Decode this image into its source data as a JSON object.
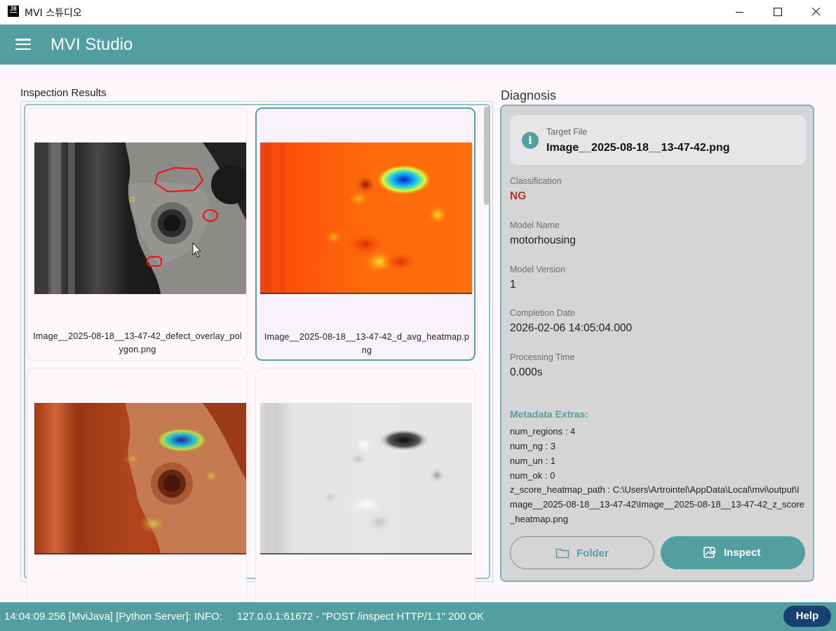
{
  "window": {
    "title": "MVI 스튜디오",
    "icon_text": "JB"
  },
  "appbar": {
    "title": "MVI Studio",
    "menu_icon": "hamburger-menu-icon"
  },
  "results": {
    "title": "Inspection Results",
    "items": [
      {
        "caption": "Image__2025-08-18__13-47-42_defect_overlay_polygon.png",
        "selected": false,
        "kind": "defect-overlay"
      },
      {
        "caption": "Image__2025-08-18__13-47-42_d_avg_heatmap.png",
        "selected": true,
        "kind": "heatmap"
      },
      {
        "caption": "",
        "selected": false,
        "kind": "heatmap-overlay"
      },
      {
        "caption": "",
        "selected": false,
        "kind": "grayscale-score"
      }
    ]
  },
  "diagnosis": {
    "title": "Diagnosis",
    "target_label": "Target File",
    "target_value": "Image__2025-08-18__13-47-42.png",
    "fields": [
      {
        "label": "Classification",
        "value": "NG"
      },
      {
        "label": "Model Name",
        "value": "motorhousing"
      },
      {
        "label": "Model Version",
        "value": "1"
      },
      {
        "label": "Completion Date",
        "value": "2026-02-06 14:05:04.000"
      },
      {
        "label": "Processing Time",
        "value": "0.000s"
      }
    ],
    "meta_title": "Metadata Extras:",
    "meta": [
      "num_regions : 4",
      "num_ng : 3",
      "num_un : 1",
      "num_ok : 0"
    ],
    "meta_path": "z_score_heatmap_path : C:\\Users\\Artrointel\\AppData\\Local\\mvi\\output\\Image__2025-08-18__13-47-42\\Image__2025-08-18__13-47-42_z_score_heatmap.png",
    "folder_button": "Folder",
    "inspect_button": "Inspect",
    "accent_color": "#539ea0",
    "ng_color": "#b7321f"
  },
  "status": {
    "text": "14:04:09.256 [MviJava] [Python Server]: INFO:     127.0.0.1:61672 - \"POST /inspect HTTP/1.1\" 200 OK",
    "help_button": "Help"
  }
}
